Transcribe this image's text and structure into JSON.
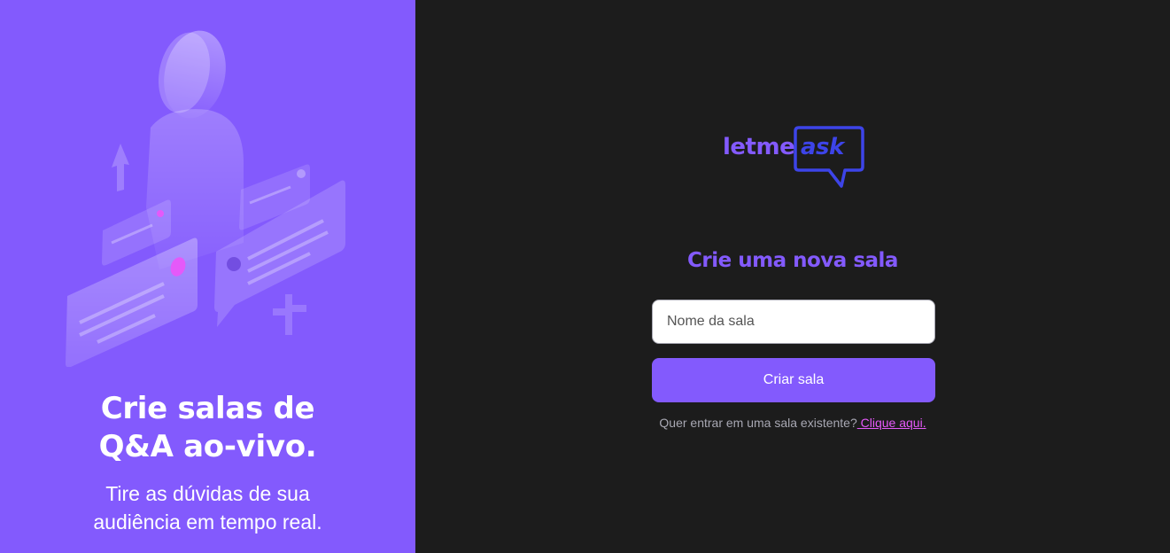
{
  "aside": {
    "title": "Crie salas de\nQ&A ao-vivo.",
    "subtitle": "Tire as dúvidas de sua\naudiência em tempo real.",
    "illustration": "question-and-answer-illustration"
  },
  "logo": {
    "part1": "letme",
    "part2": "ask"
  },
  "form": {
    "title": "Crie uma nova sala",
    "room_name_placeholder": "Nome da sala",
    "room_name_value": "",
    "submit_label": "Criar sala",
    "join_prompt": "Quer entrar em uma sala existente?",
    "join_link": " Clique aqui."
  },
  "colors": {
    "brand_purple": "#835afd",
    "dark_background": "#1c1c1c",
    "link_pink": "#e559f9",
    "logo_blue": "#3d44e8"
  }
}
